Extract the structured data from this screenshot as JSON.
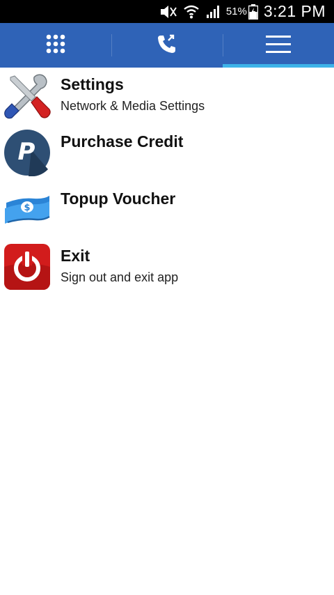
{
  "status_bar": {
    "battery_percent": "51%",
    "time": "3:21 PM",
    "icons": [
      "mute-icon",
      "wifi-icon",
      "signal-icon",
      "battery-charging-icon"
    ]
  },
  "tabs": [
    {
      "name": "dialpad",
      "icon": "dialpad-icon",
      "active": false
    },
    {
      "name": "calls",
      "icon": "phone-icon",
      "active": false
    },
    {
      "name": "menu",
      "icon": "hamburger-menu-icon",
      "active": true
    }
  ],
  "menu": {
    "items": [
      {
        "title": "Settings",
        "subtitle": "Network & Media Settings",
        "icon": "settings-tools-icon"
      },
      {
        "title": "Purchase Credit",
        "subtitle": "",
        "icon": "paypal-icon"
      },
      {
        "title": "Topup Voucher",
        "subtitle": "",
        "icon": "money-voucher-icon"
      },
      {
        "title": "Exit",
        "subtitle": "Sign out and exit app",
        "icon": "power-icon"
      }
    ]
  },
  "colors": {
    "tab_bar": "#2f63b7",
    "active_indicator": "#3db3e8",
    "status_bar": "#000000"
  }
}
